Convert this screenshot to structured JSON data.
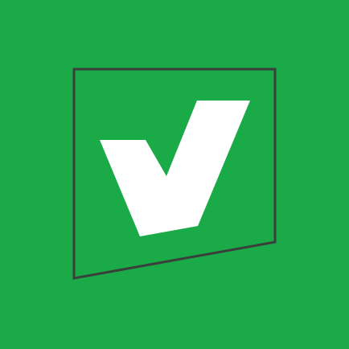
{
  "icon": {
    "name": "check-logo-icon",
    "background_color": "#1aab48",
    "frame_color": "#3a3f3b",
    "mark_color": "#ffffff"
  }
}
